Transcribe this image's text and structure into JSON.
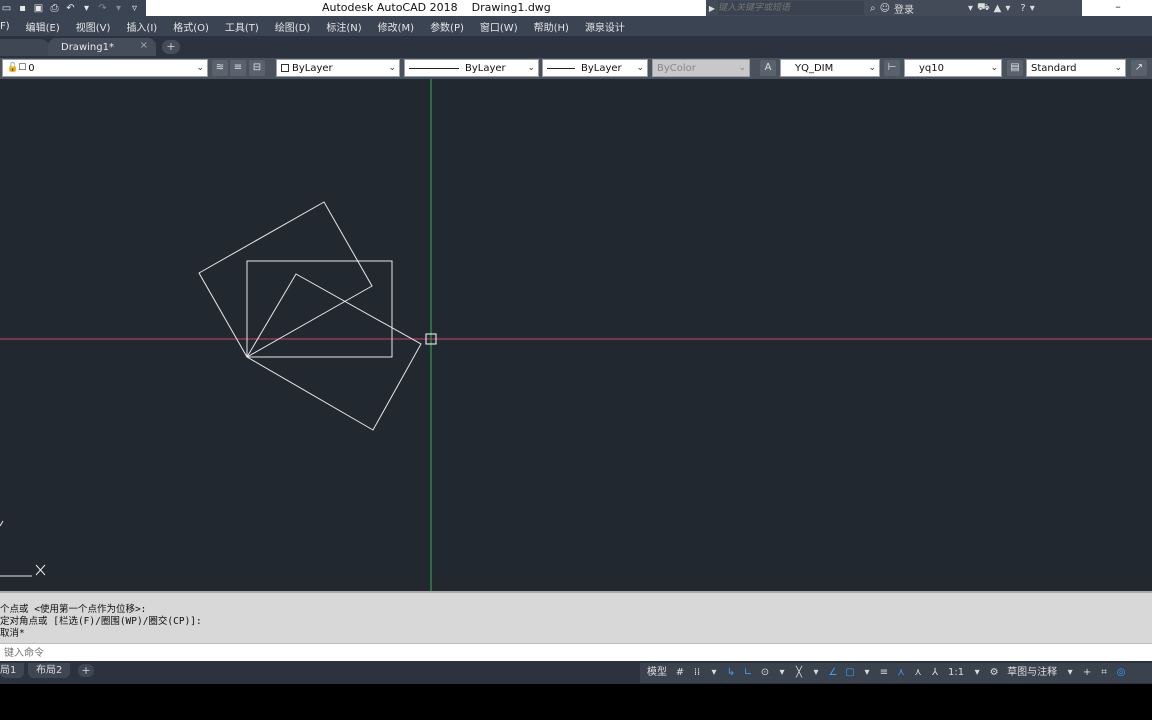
{
  "app": {
    "title": "Autodesk AutoCAD 2018",
    "file": "Drawing1.dwg"
  },
  "search": {
    "placeholder": "键入关键字或短语"
  },
  "account": {
    "login_label": "登录"
  },
  "menu": [
    "F)",
    "编辑(E)",
    "视图(V)",
    "插入(I)",
    "格式(O)",
    "工具(T)",
    "绘图(D)",
    "标注(N)",
    "修改(M)",
    "参数(P)",
    "窗口(W)",
    "帮助(H)",
    "源泉设计"
  ],
  "tabs": {
    "drawing_label": "Drawing1*",
    "close_glyph": "×",
    "add_glyph": "+"
  },
  "properties": {
    "layer": "0",
    "color": "ByLayer",
    "linetype": "ByLayer",
    "lineweight": "ByLayer",
    "plotstyle": "ByColor",
    "dimstyle": "YQ_DIM",
    "textstyle": "yq10",
    "tablestyle": "Standard"
  },
  "command_history": [
    "个点或 <使用第一个点作为位移>:",
    "定对角点或 [栏选(F)/圈围(WP)/圈交(CP)]:",
    "取消*"
  ],
  "command_input": {
    "placeholder": "键入命令"
  },
  "layouts": {
    "tab1": "局1",
    "tab2": "布局2",
    "add_glyph": "+"
  },
  "status": {
    "model": "模型",
    "scale": "1:1",
    "workspace": "草图与注释"
  },
  "colors": {
    "canvas_bg": "#212830",
    "crosshair_x": "#d04060",
    "crosshair_y": "#3ab04a",
    "geometry": "#e8e8e8",
    "accent_blue": "#3aa0ff"
  },
  "icons": {
    "quick_access": [
      "folder-icon",
      "save-icon",
      "saveas-icon",
      "print-icon",
      "undo-icon",
      "redo-icon",
      "dropdown-icon"
    ],
    "status": [
      "grid-icon",
      "snap-icon",
      "ortho-icon",
      "polar-icon",
      "osnap-icon",
      "otrack-icon",
      "lineweight-icon",
      "annotation-icon",
      "gear-icon",
      "plus-icon",
      "isolate-icon",
      "hardware-accel-icon"
    ]
  }
}
